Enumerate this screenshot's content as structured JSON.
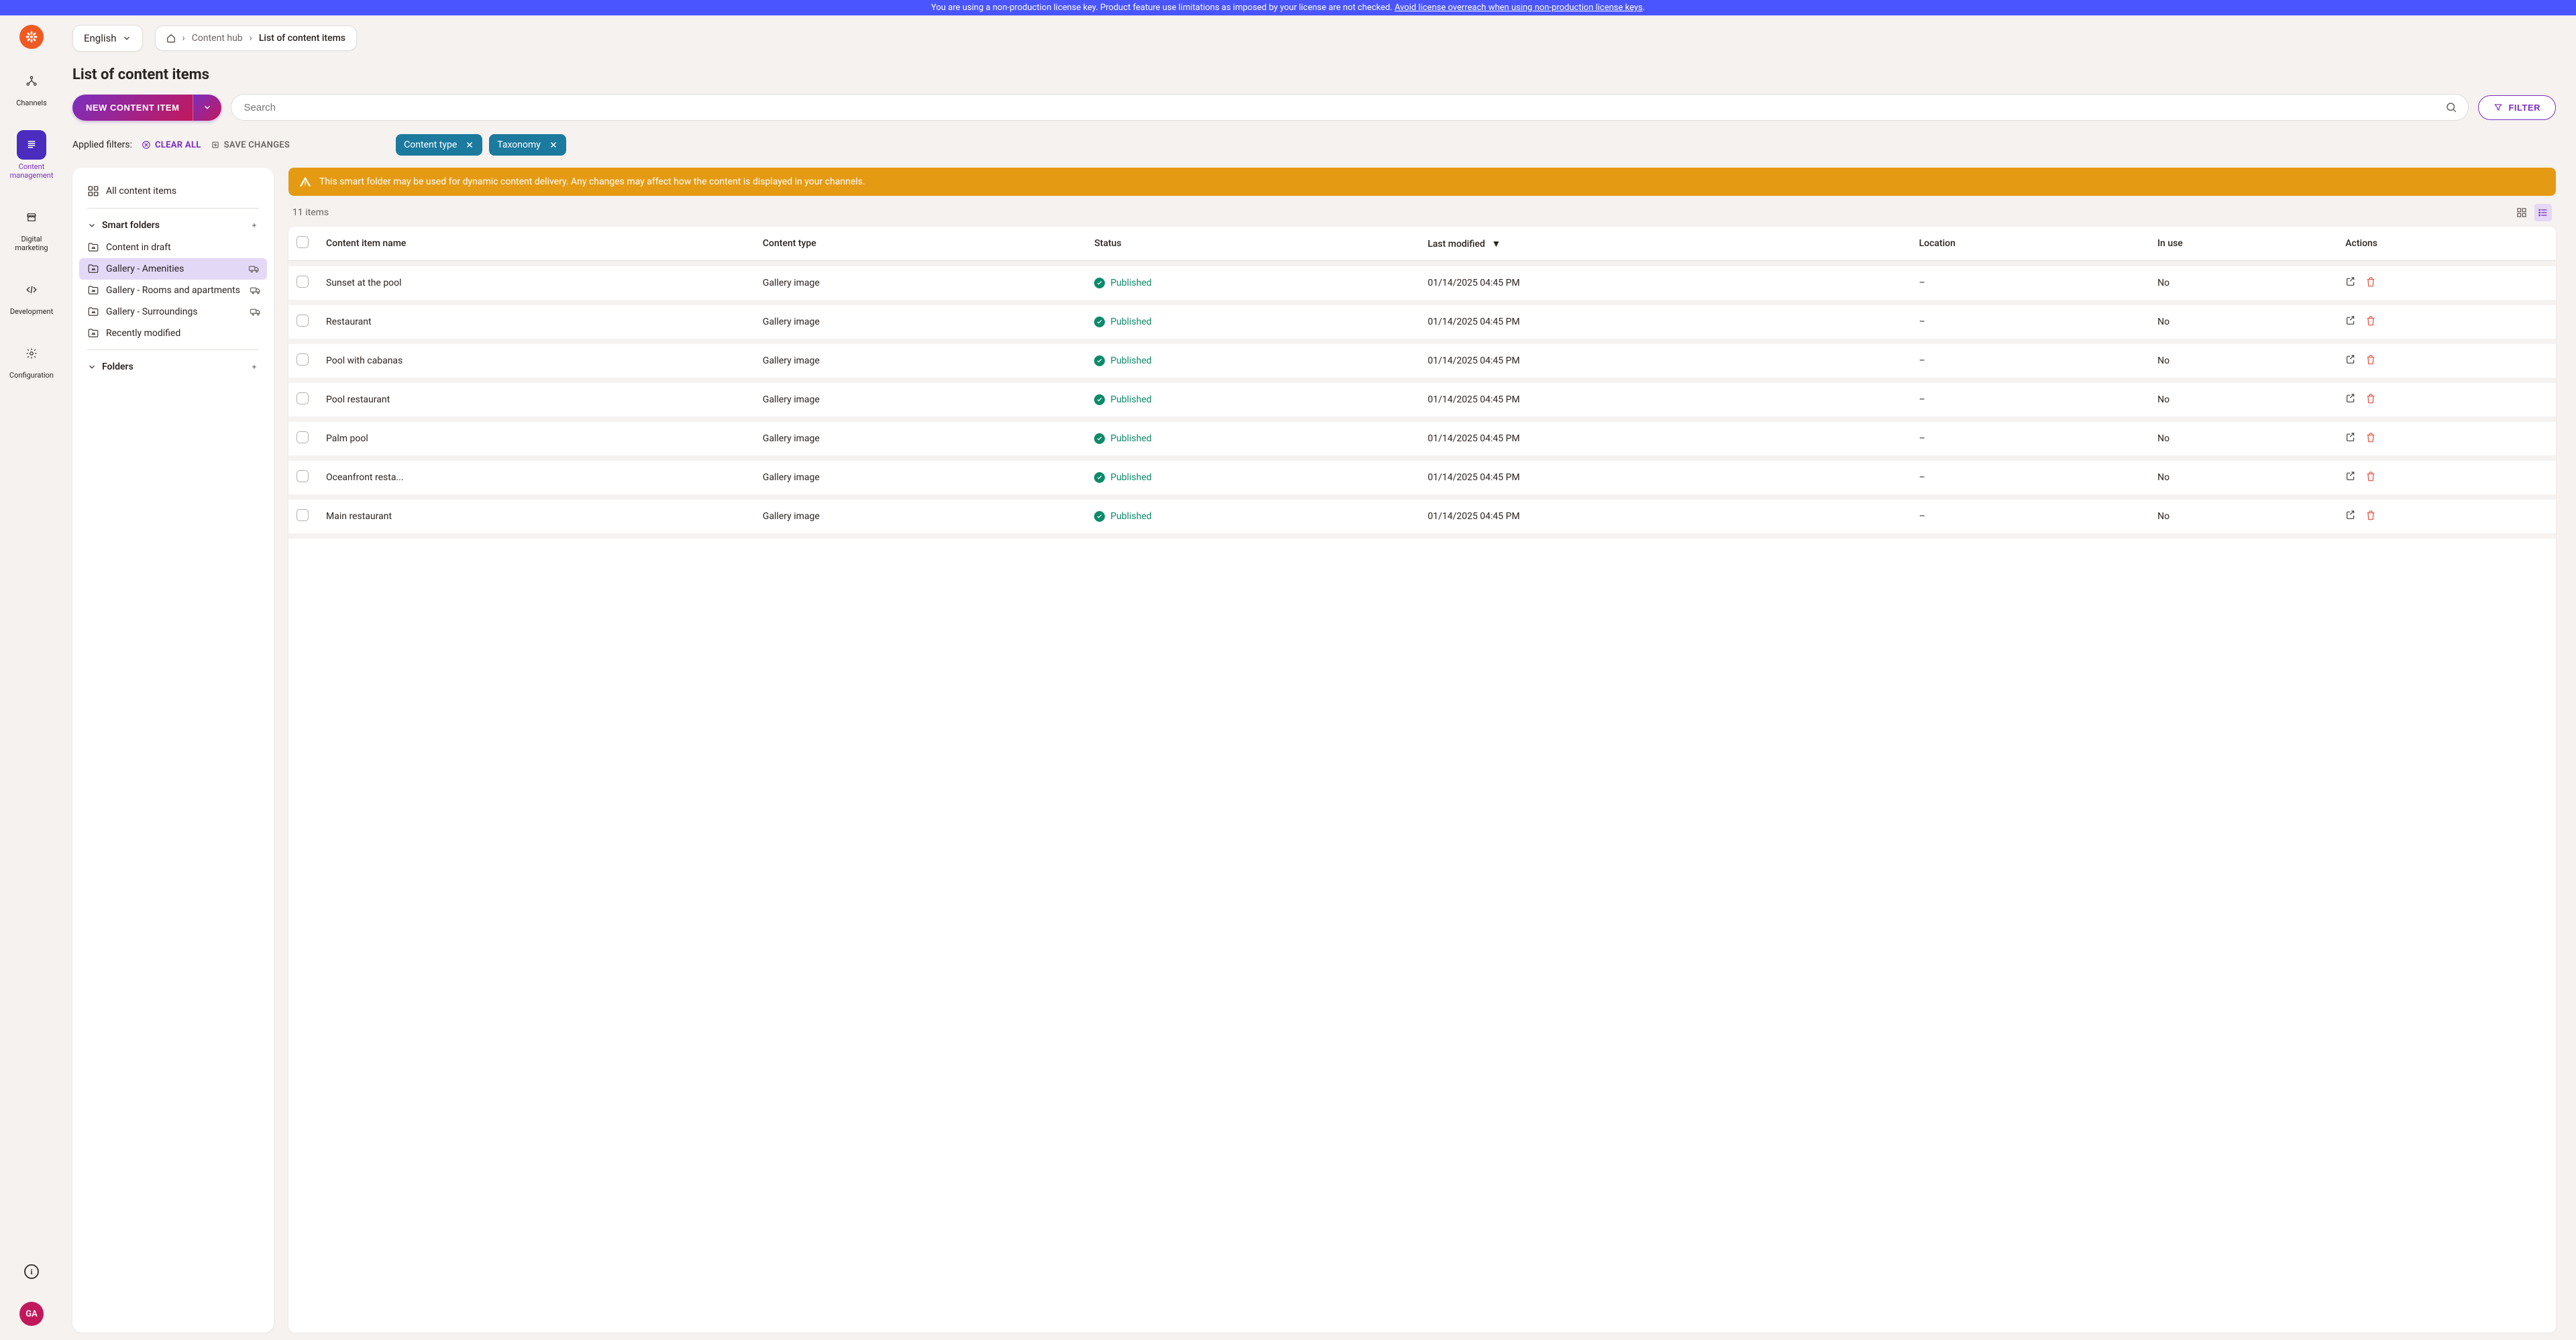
{
  "banner": {
    "text_before_link": "You are using a non-production license key. Product feature use limitations as imposed by your license are not checked. ",
    "link_text": "Avoid license overreach when using non-production license keys",
    "text_after_link": "."
  },
  "nav": {
    "items": [
      {
        "label": "Channels"
      },
      {
        "label": "Content management"
      },
      {
        "label": "Digital marketing"
      },
      {
        "label": "Development"
      },
      {
        "label": "Configuration"
      }
    ],
    "avatar": "GA"
  },
  "header": {
    "language": "English",
    "breadcrumb": {
      "content_hub": "Content hub",
      "current": "List of content items"
    },
    "page_title": "List of content items"
  },
  "actions": {
    "new_button": "NEW CONTENT ITEM",
    "search_placeholder": "Search",
    "filter_button": "FILTER"
  },
  "filters": {
    "applied_label": "Applied filters:",
    "clear_all": "CLEAR ALL",
    "save_changes": "SAVE CHANGES",
    "tags": [
      "Content type",
      "Taxonomy"
    ]
  },
  "folders": {
    "all_label": "All content items",
    "smart_header": "Smart folders",
    "folders_header": "Folders",
    "smart_items": [
      {
        "label": "Content in draft",
        "delivery": false
      },
      {
        "label": "Gallery - Amenities",
        "delivery": true,
        "active": true
      },
      {
        "label": "Gallery - Rooms and apartments",
        "delivery": true
      },
      {
        "label": "Gallery - Surroundings",
        "delivery": true
      },
      {
        "label": "Recently modified",
        "delivery": false
      }
    ]
  },
  "warning": {
    "text": "This smart folder may be used for dynamic content delivery. Any changes may affect how the content is displayed in your channels."
  },
  "table": {
    "count_label": "11 items",
    "columns": {
      "name": "Content item name",
      "type": "Content type",
      "status": "Status",
      "modified": "Last modified",
      "location": "Location",
      "in_use": "In use",
      "actions": "Actions"
    },
    "rows": [
      {
        "name": "Sunset at the pool",
        "type": "Gallery image",
        "status": "Published",
        "modified": "01/14/2025 04:45 PM",
        "location": "–",
        "in_use": "No"
      },
      {
        "name": "Restaurant",
        "type": "Gallery image",
        "status": "Published",
        "modified": "01/14/2025 04:45 PM",
        "location": "–",
        "in_use": "No"
      },
      {
        "name": "Pool with cabanas",
        "type": "Gallery image",
        "status": "Published",
        "modified": "01/14/2025 04:45 PM",
        "location": "–",
        "in_use": "No"
      },
      {
        "name": "Pool restaurant",
        "type": "Gallery image",
        "status": "Published",
        "modified": "01/14/2025 04:45 PM",
        "location": "–",
        "in_use": "No"
      },
      {
        "name": "Palm pool",
        "type": "Gallery image",
        "status": "Published",
        "modified": "01/14/2025 04:45 PM",
        "location": "–",
        "in_use": "No"
      },
      {
        "name": "Oceanfront resta...",
        "type": "Gallery image",
        "status": "Published",
        "modified": "01/14/2025 04:45 PM",
        "location": "–",
        "in_use": "No"
      },
      {
        "name": "Main restaurant",
        "type": "Gallery image",
        "status": "Published",
        "modified": "01/14/2025 04:45 PM",
        "location": "–",
        "in_use": "No"
      }
    ]
  }
}
